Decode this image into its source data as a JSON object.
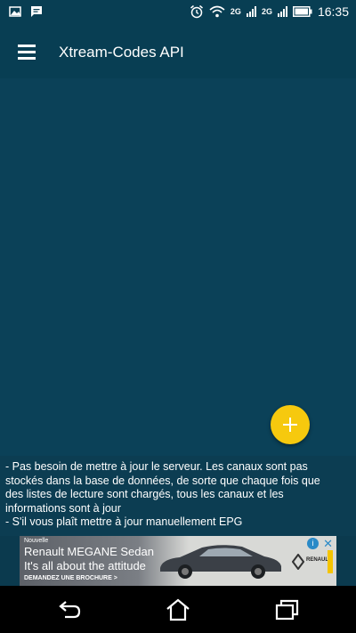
{
  "status_bar": {
    "time": "16:35",
    "network_1": "2G",
    "network_2": "2G",
    "icons": [
      "image-icon",
      "message-icon",
      "alarm-icon",
      "wifi-icon",
      "signal-icon",
      "signal-icon",
      "battery-icon"
    ]
  },
  "app_bar": {
    "menu_icon": "hamburger-menu-icon",
    "title": "Xtream-Codes API"
  },
  "fab": {
    "icon": "plus-icon",
    "color": "#f6c90e"
  },
  "info": {
    "lines": [
      "- Pas besoin de mettre à jour le serveur. Les canaux sont pas",
      "stockés dans la base de données, de sorte que chaque fois que",
      "des listes de lecture sont chargés, tous les canaux et les",
      "informations sont à jour",
      "- S'il vous plaît mettre à jour manuellement EPG"
    ]
  },
  "ad": {
    "label": "Nouvelle",
    "model": "Renault MEGANE Sedan",
    "tagline": "It's all about the attitude",
    "cta": "DEMANDEZ UNE BROCHURE  >",
    "brand": "RENAULT"
  },
  "nav": {
    "icons": [
      "back-icon",
      "home-icon",
      "recent-apps-icon"
    ]
  },
  "colors": {
    "primary": "#083e53",
    "background": "#0b4158",
    "accent": "#f6c90e"
  }
}
